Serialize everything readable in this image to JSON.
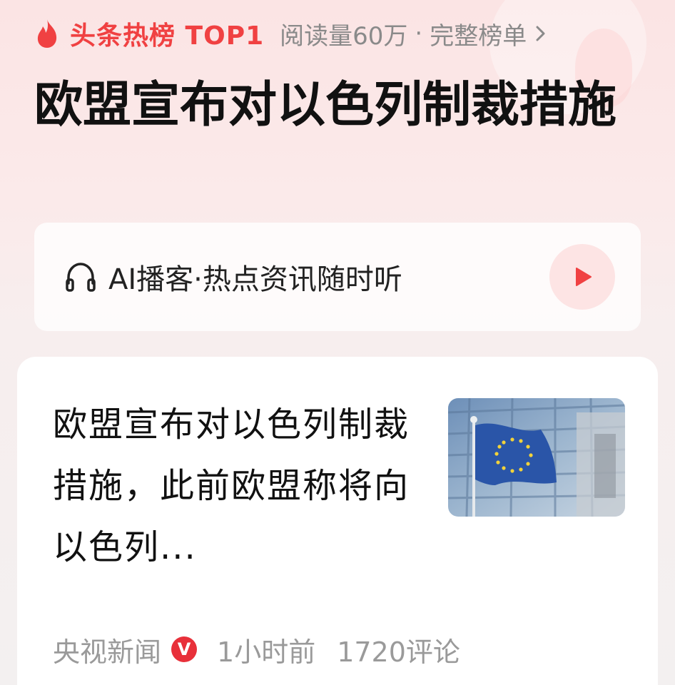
{
  "header": {
    "hot_label": "头条热榜 TOP1",
    "reads": "阅读量60万",
    "separator": "·",
    "full_list": "完整榜单",
    "headline": "欧盟宣布对以色列制裁措施",
    "icons": [
      "flame-icon",
      "chevron-right-icon"
    ]
  },
  "podcast": {
    "text": "AI播客·热点资讯随时听",
    "icons": [
      "headphones-icon",
      "play-icon"
    ]
  },
  "article": {
    "title": "欧盟宣布对以色列制裁措施，此前欧盟称将向以色列...",
    "source": "央视新闻",
    "verified_badge": "V",
    "time": "1小时前",
    "comments": "1720评论",
    "thumbnail": "eu-flag-image"
  },
  "colors": {
    "accent_red": "#f04142",
    "badge_red": "#e8303a",
    "play_bg": "#fde4e4",
    "muted_text": "#9a9a9a"
  }
}
